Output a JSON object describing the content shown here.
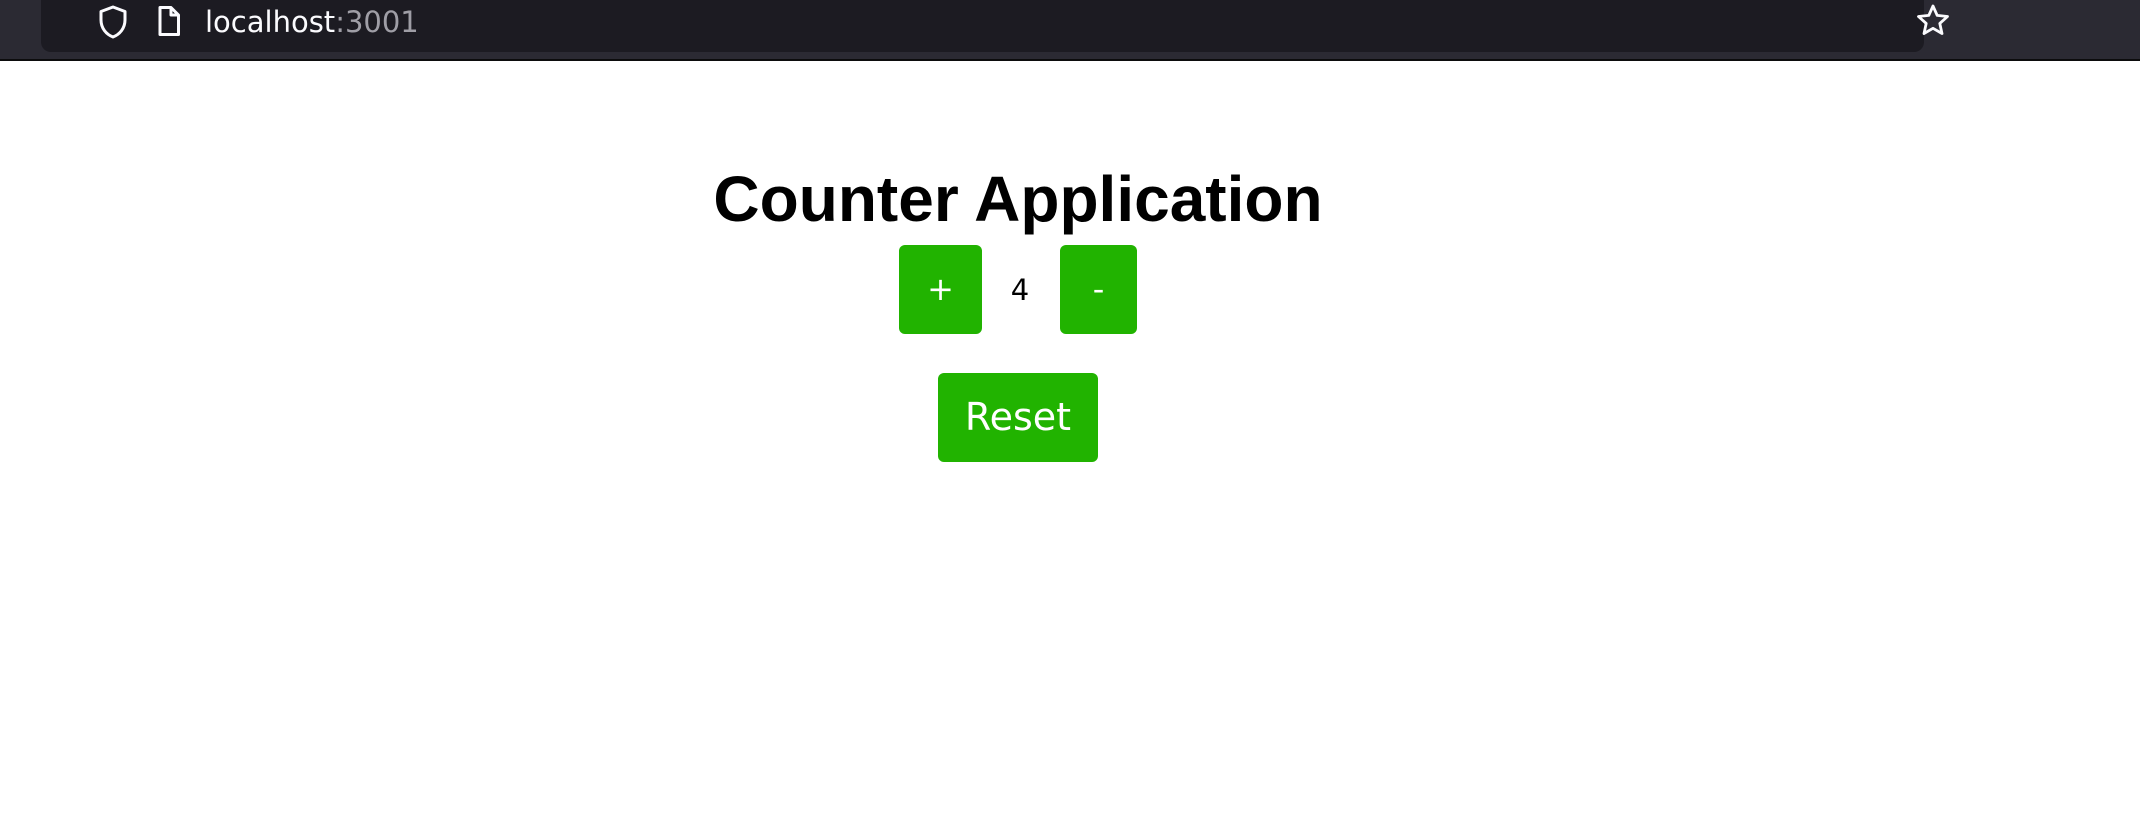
{
  "browser": {
    "url_host": "localhost",
    "url_port": ":3001",
    "icons": {
      "shield": "shield-icon",
      "page": "page-icon",
      "bookmark": "star-icon"
    }
  },
  "app": {
    "title": "Counter Application",
    "increment_label": "+",
    "decrement_label": "-",
    "count": "4",
    "reset_label": "Reset"
  },
  "colors": {
    "button_background": "#21b300",
    "button_text": "#ffffff",
    "chrome_background": "#2b2a33",
    "url_bar_background": "#1c1b22",
    "page_background": "#ffffff"
  }
}
